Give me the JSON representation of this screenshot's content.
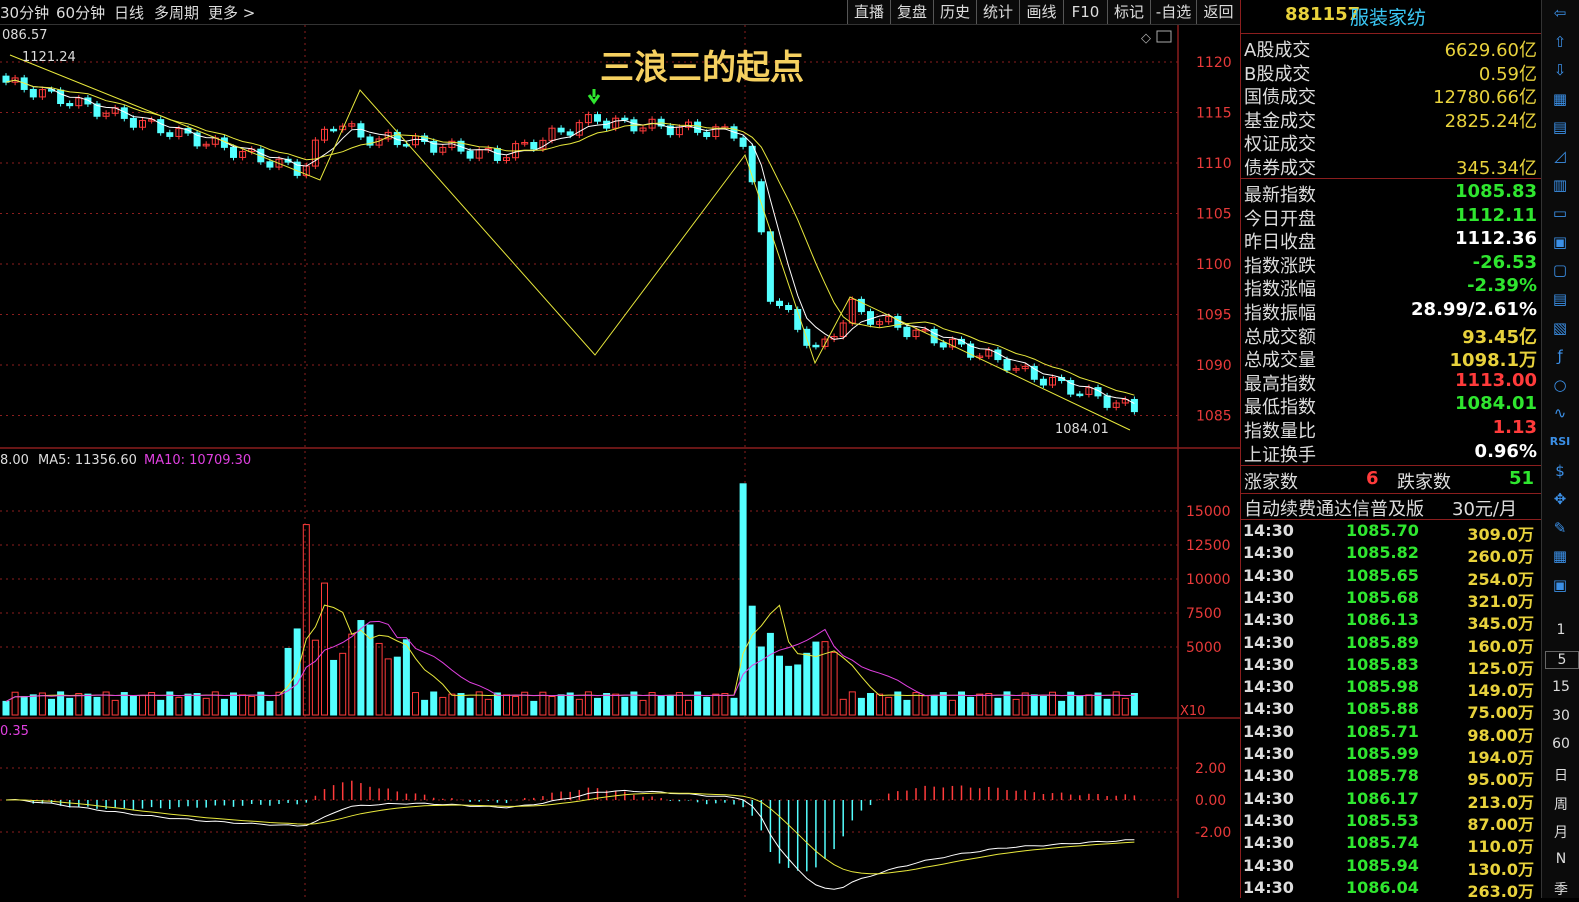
{
  "toolbar": {
    "periods": [
      "30分钟",
      "60分钟",
      "日线",
      "多周期",
      "更多 >"
    ],
    "buttons": [
      "直播",
      "复盘",
      "历史",
      "统计",
      "画线",
      "F10",
      "标记",
      "-自选",
      "返回"
    ]
  },
  "chart": {
    "price_top_left": "086.57",
    "high_marker": "1121.24",
    "low_marker": "1084.01",
    "annotation": "三浪三的起点",
    "price_axis": [
      "1120",
      "1115",
      "1110",
      "1105",
      "1100",
      "1095",
      "1090",
      "1085"
    ],
    "vol_legend": {
      "prefix": "8.00",
      "ma5": "MA5: 11356.60",
      "ma10": "MA10: 10709.30"
    },
    "vol_axis": [
      "15000",
      "12500",
      "10000",
      "7500",
      "5000"
    ],
    "vol_unit": "X10",
    "macd_legend": "0.35",
    "macd_axis": [
      "2.00",
      "0.00",
      "-2.00"
    ],
    "colors": {
      "up": "#ff3b3b",
      "down": "#54ffff",
      "ma_yellow": "#e8e83c",
      "ma_white": "#ffffff",
      "ma_magenta": "#e040e0",
      "grid": "#8b1e1e",
      "axis_text": "#e83a3a",
      "arrow": "#2fe62f"
    }
  },
  "panel": {
    "code": "881157",
    "name": "服装家纺",
    "market": [
      {
        "k": "A股成交",
        "v": "6629.60亿"
      },
      {
        "k": "B股成交",
        "v": "0.59亿"
      },
      {
        "k": "国债成交",
        "v": "12780.66亿"
      },
      {
        "k": "基金成交",
        "v": "2825.24亿"
      },
      {
        "k": "权证成交",
        "v": ""
      },
      {
        "k": "债券成交",
        "v": "345.34亿"
      }
    ],
    "index": [
      {
        "k": "最新指数",
        "v": "1085.83",
        "c": "#2fe62f"
      },
      {
        "k": "今日开盘",
        "v": "1112.11",
        "c": "#2fe62f"
      },
      {
        "k": "昨日收盘",
        "v": "1112.36",
        "c": "#ffffff"
      },
      {
        "k": "指数涨跌",
        "v": "-26.53",
        "c": "#2fe62f"
      },
      {
        "k": "指数涨幅",
        "v": "-2.39%",
        "c": "#2fe62f"
      },
      {
        "k": "指数振幅",
        "v": "28.99/2.61%",
        "c": "#ffffff"
      },
      {
        "k": "总成交额",
        "v": "93.45亿",
        "c": "#e8d23c"
      },
      {
        "k": "总成交量",
        "v": "1098.1万",
        "c": "#e8d23c"
      },
      {
        "k": "最高指数",
        "v": "1113.00",
        "c": "#ff3b3b"
      },
      {
        "k": "最低指数",
        "v": "1084.01",
        "c": "#2fe62f"
      },
      {
        "k": "指数量比",
        "v": "1.13",
        "c": "#ff3b3b"
      },
      {
        "k": "上证换手",
        "v": "0.96%",
        "c": "#ffffff"
      }
    ],
    "breadth": {
      "up_label": "涨家数",
      "up": "6",
      "down_label": "跌家数",
      "down": "51"
    },
    "ad": {
      "text": "自动续费通达信普及版",
      "price": "30元/月"
    },
    "ticks": [
      {
        "t": "14:30",
        "p": "1085.70",
        "v": "309.0万"
      },
      {
        "t": "14:30",
        "p": "1085.82",
        "v": "260.0万"
      },
      {
        "t": "14:30",
        "p": "1085.65",
        "v": "254.0万"
      },
      {
        "t": "14:30",
        "p": "1085.68",
        "v": "321.0万"
      },
      {
        "t": "14:30",
        "p": "1086.13",
        "v": "345.0万"
      },
      {
        "t": "14:30",
        "p": "1085.89",
        "v": "160.0万"
      },
      {
        "t": "14:30",
        "p": "1085.83",
        "v": "125.0万"
      },
      {
        "t": "14:30",
        "p": "1085.98",
        "v": "149.0万"
      },
      {
        "t": "14:30",
        "p": "1085.88",
        "v": "75.00万"
      },
      {
        "t": "14:30",
        "p": "1085.71",
        "v": "98.00万"
      },
      {
        "t": "14:30",
        "p": "1085.99",
        "v": "194.0万"
      },
      {
        "t": "14:30",
        "p": "1085.78",
        "v": "95.00万"
      },
      {
        "t": "14:30",
        "p": "1086.17",
        "v": "213.0万"
      },
      {
        "t": "14:30",
        "p": "1085.53",
        "v": "87.00万"
      },
      {
        "t": "14:30",
        "p": "1085.74",
        "v": "110.0万"
      },
      {
        "t": "14:30",
        "p": "1085.94",
        "v": "130.0万"
      },
      {
        "t": "14:30",
        "p": "1086.04",
        "v": "263.0万"
      }
    ]
  },
  "strip": {
    "icons": [
      "arrow-left-icon",
      "arrow-up-icon",
      "arrow-down-icon",
      "grid-icon",
      "table-icon",
      "chart-icon",
      "candle-icon",
      "list-icon",
      "fio-icon",
      "doc-icon",
      "note-icon",
      "fiz-icon",
      "fx-icon",
      "circle-icon",
      "wave-icon",
      "rsi-icon",
      "dollar-icon",
      "move-icon",
      "pen-icon",
      "fs-icon",
      "refresh-icon"
    ],
    "rsi_label": "RSI",
    "periods": [
      "1",
      "5",
      "15",
      "30",
      "60",
      "日",
      "周",
      "月",
      "N",
      "季"
    ]
  }
}
